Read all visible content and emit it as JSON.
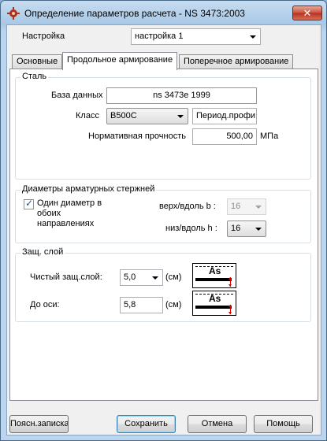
{
  "window": {
    "title": "Определение параметров расчета - NS 3473:2003",
    "close_glyph": "✕",
    "icon": "app-gear-icon"
  },
  "settings": {
    "label": "Настройка",
    "value": "настройка 1"
  },
  "tabs": [
    {
      "label": "Основные",
      "active": false
    },
    {
      "label": "Продольное армирование",
      "active": true
    },
    {
      "label": "Поперечное армирование",
      "active": false
    }
  ],
  "steel": {
    "title": "Сталь",
    "database_label": "База данных",
    "database_value": "ns 3473e 1999",
    "class_label": "Класс",
    "class_value": "B500C",
    "profile_value": "Период.профи",
    "strength_label": "Нормативная прочность",
    "strength_value": "500,00",
    "strength_unit": "МПа"
  },
  "diameters": {
    "title": "Диаметры арматурных стержней",
    "checkbox_label_line1": "Один диаметр в",
    "checkbox_label_line2": "обоих",
    "checkbox_label_line3": "направлениях",
    "checkbox_checked": true,
    "top_label": "верх/вдоль b :",
    "top_value": "16",
    "bottom_label": "низ/вдоль h :",
    "bottom_value": "16"
  },
  "cover": {
    "title": "Защ. слой",
    "clear_label": "Чистый защ.слой:",
    "clear_value": "5,0",
    "clear_unit": "(см)",
    "axis_label": "До оси:",
    "axis_value": "5,8",
    "axis_unit": "(см)",
    "diagram_text": "As"
  },
  "buttons": {
    "notes": "Пояcн.записка",
    "save": "Сохранить",
    "cancel": "Отмена",
    "help": "Помощь"
  }
}
